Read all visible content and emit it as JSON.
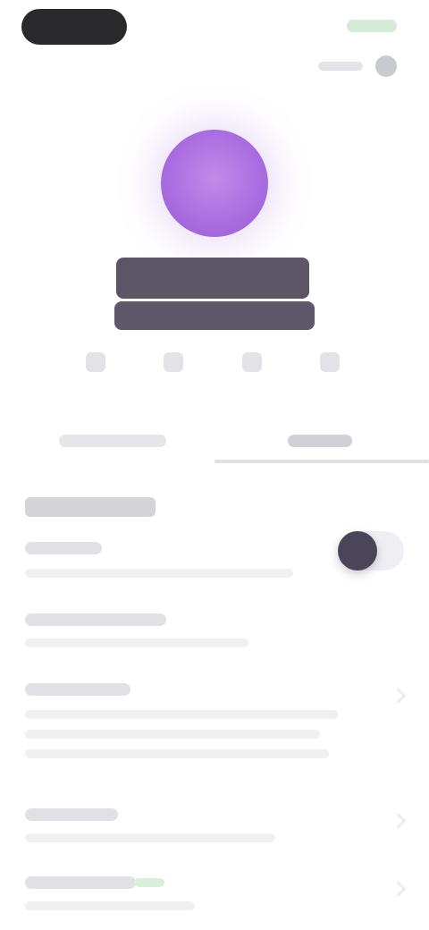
{
  "profile": {
    "avatar_initials": "",
    "name": ""
  },
  "tabs": [
    {
      "label": ""
    },
    {
      "label": ""
    }
  ],
  "section": {
    "title": "",
    "rows": [
      {
        "title": "",
        "subtitle": "",
        "control": "toggle",
        "toggle_on": true
      },
      {
        "title": "",
        "subtitle": "",
        "control": "chevron"
      },
      {
        "title": "",
        "subtitle": "",
        "control": "chevron"
      },
      {
        "title": "",
        "subtitle": "",
        "control": "chevron"
      },
      {
        "title": "",
        "subtitle": "",
        "control": "chevron"
      }
    ]
  },
  "icons": {
    "top_right": "avatar-icon",
    "chevron": "chevron-right-icon"
  },
  "colors": {
    "avatar": "#a86ce0",
    "toggle_knob": "#4a4558",
    "status_accent": "#d5ead8"
  }
}
